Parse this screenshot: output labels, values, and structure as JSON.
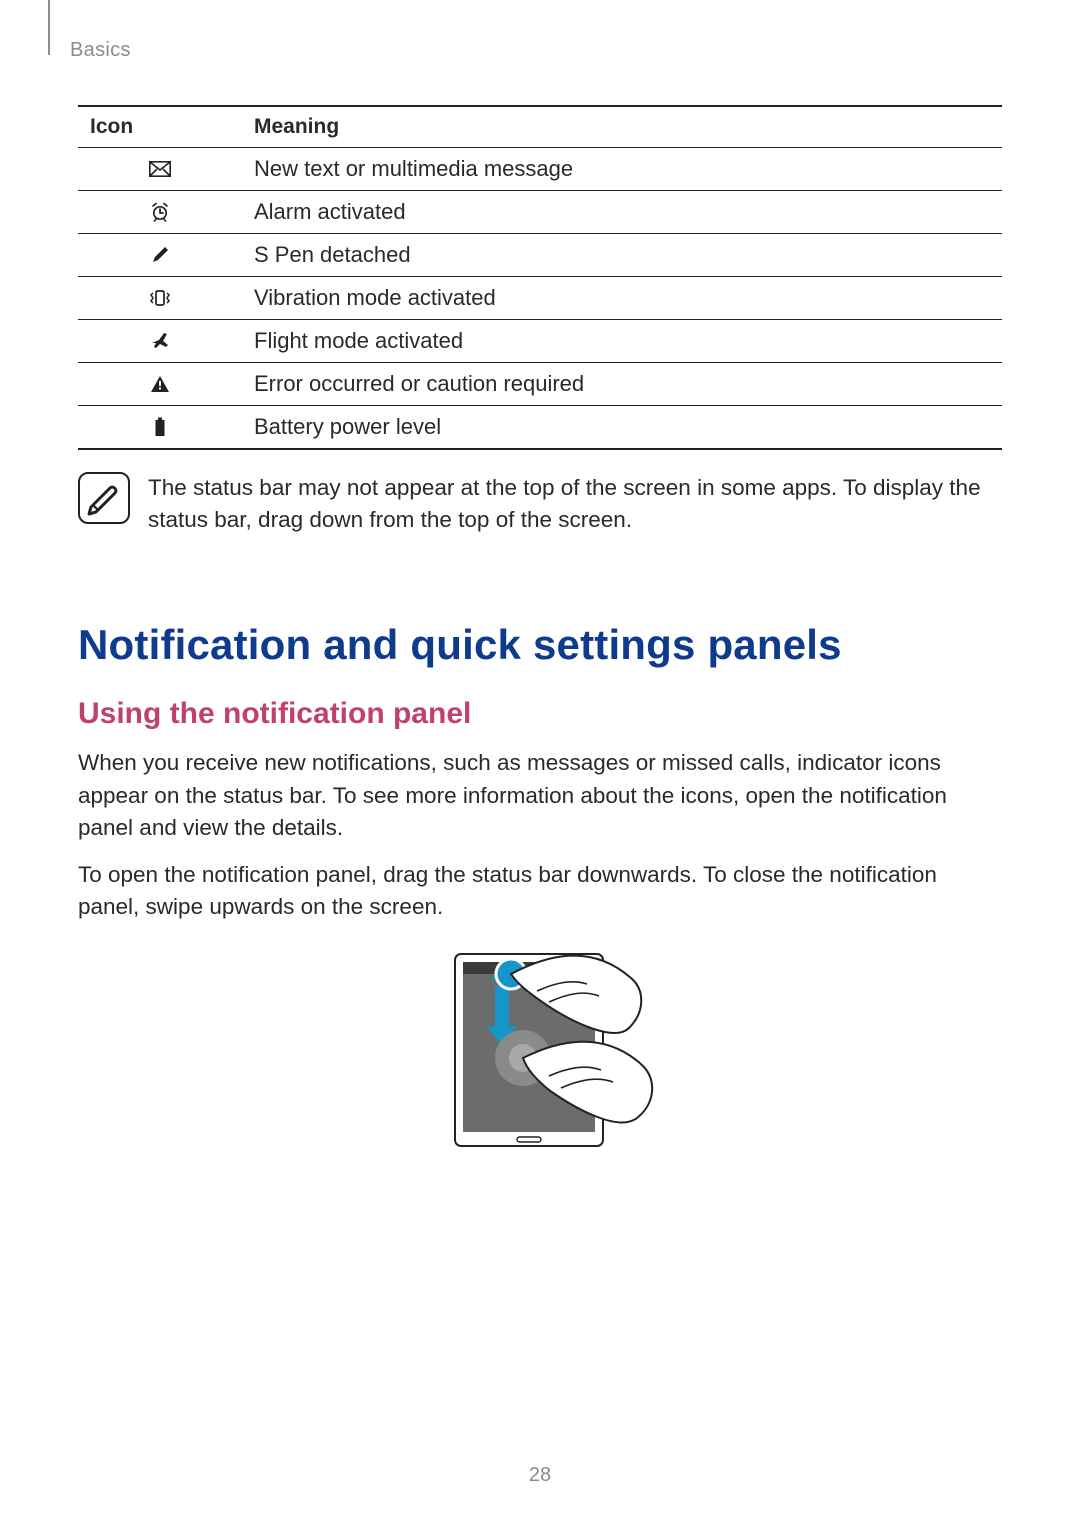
{
  "header": {
    "section": "Basics"
  },
  "table": {
    "head": {
      "icon": "Icon",
      "meaning": "Meaning"
    },
    "rows": [
      {
        "icon": "message-icon",
        "meaning": "New text or multimedia message"
      },
      {
        "icon": "alarm-icon",
        "meaning": "Alarm activated"
      },
      {
        "icon": "spen-icon",
        "meaning": "S Pen detached"
      },
      {
        "icon": "vibration-icon",
        "meaning": "Vibration mode activated"
      },
      {
        "icon": "flight-icon",
        "meaning": "Flight mode activated"
      },
      {
        "icon": "warning-icon",
        "meaning": "Error occurred or caution required"
      },
      {
        "icon": "battery-icon",
        "meaning": "Battery power level"
      }
    ]
  },
  "note": {
    "text": "The status bar may not appear at the top of the screen in some apps. To display the status bar, drag down from the top of the screen."
  },
  "h1": "Notification and quick settings panels",
  "h2": "Using the notification panel",
  "p1": "When you receive new notifications, such as messages or missed calls, indicator icons appear on the status bar. To see more information about the icons, open the notification panel and view the details.",
  "p2": "To open the notification panel, drag the status bar downwards. To close the notification panel, swipe upwards on the screen.",
  "pageNumber": "28"
}
